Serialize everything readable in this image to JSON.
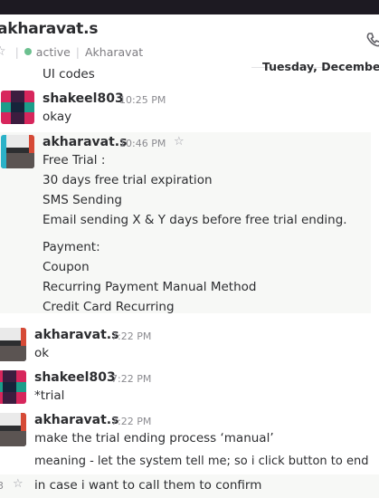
{
  "header": {
    "title": "akharavat.s",
    "presence": "active",
    "username": "Akharavat"
  },
  "date_divider": "Tuesday, Decembe",
  "continuation": "UI codes",
  "messages": [
    {
      "author": "shakeel803",
      "time": "10:25 PM",
      "lines": [
        "okay"
      ]
    },
    {
      "author": "akharavat.s",
      "time": "10:46 PM",
      "lines": [
        "Free Trial :",
        "30 days free trial expiration",
        "SMS Sending",
        "Email sending X & Y days before free trial ending.",
        "Payment:",
        "Coupon",
        "Recurring Payment Manual Method",
        "Credit Card Recurring"
      ]
    },
    {
      "author": "akharavat.s",
      "time": "7:22 PM",
      "lines": [
        "ok"
      ]
    },
    {
      "author": "shakeel803",
      "time": "7:22 PM",
      "lines": [
        "*trial"
      ]
    },
    {
      "author": "akharavat.s",
      "time": "7:22 PM",
      "lines": [
        "make the trial ending process ‘manual’",
        "meaning - let the system tell me; so i click button to end",
        "in case i want to call them to confirm"
      ]
    }
  ],
  "bottom_row_number": "3",
  "colors": {
    "presence": "#6cc08f",
    "topbar": "#1d1a22",
    "highlight": "#f7f8f6"
  }
}
